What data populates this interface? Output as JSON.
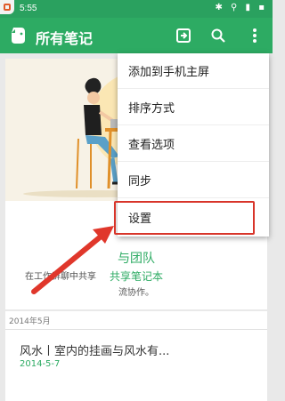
{
  "status_bar": {
    "time": "5:55",
    "icons": "✱ ⚲ ▮ ▪"
  },
  "app_bar": {
    "title": "所有笔记"
  },
  "promo": {
    "title": "与团队",
    "text_line1": "在工作群聊中共享",
    "text_line2": "流协作。",
    "link": "共享笔记本"
  },
  "notes": {
    "section_header": "2014年5月",
    "items": [
      {
        "title": "风水丨室内的挂画与风水有...",
        "date": "2014-5-7"
      }
    ]
  },
  "menu": {
    "items": [
      {
        "label": "添加到手机主屏"
      },
      {
        "label": "排序方式"
      },
      {
        "label": "查看选项"
      },
      {
        "label": "同步"
      },
      {
        "label": "设置"
      }
    ]
  },
  "colors": {
    "brand": "#2dab63",
    "highlight": "#d8352a"
  }
}
